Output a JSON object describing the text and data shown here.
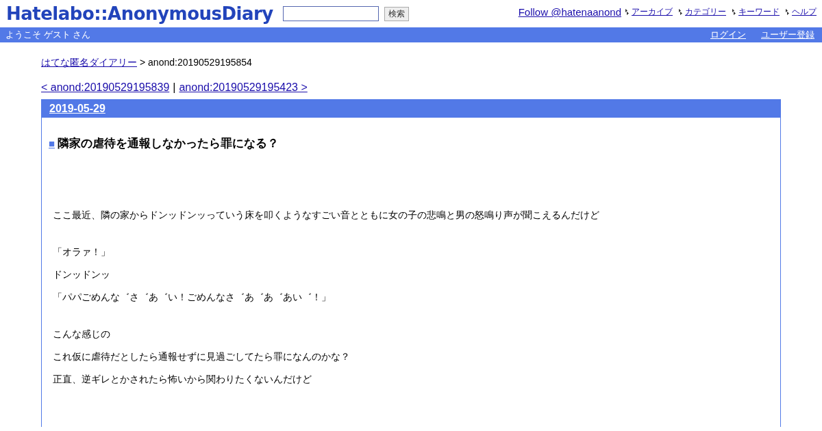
{
  "logo": "Hatelabo::AnonymousDiary",
  "search": {
    "button": "検索"
  },
  "follow": "Follow @hatenaanond",
  "nav": [
    "アーカイブ",
    "カテゴリー",
    "キーワード",
    "ヘルプ"
  ],
  "welcome": "ようこそ ゲスト さん",
  "account": [
    "ログイン",
    "ユーザー登録"
  ],
  "breadcrumb": {
    "link": "はてな匿名ダイアリー",
    "rest": "> anond:20190529195854"
  },
  "pager": {
    "prev": "< anond:20190529195839",
    "sep": "|",
    "next": "anond:20190529195423 >"
  },
  "date": "2019-05-29",
  "entry": {
    "mark": "■",
    "title": "隣家の虐待を通報しなかったら罪になる？",
    "sections": [
      [
        "ここ最近、隣の家からドンッドンッっていう床を叩くようなすごい音とともに女の子の悲鳴と男の怒鳴り声が聞こえるんだけど"
      ],
      [
        "「オラァ！」",
        "ドンッドンッ",
        "「パパごめんな゛さ゛あ゛い！ごめんなさ゛あ゛あ゛あい゛！」"
      ],
      [
        "こんな感じの",
        "これ仮に虐待だとしたら通報せずに見過ごしてたら罪になんのかな？",
        "正直、逆ギレとかされたら怖いから関わりたくないんだけど"
      ]
    ]
  }
}
